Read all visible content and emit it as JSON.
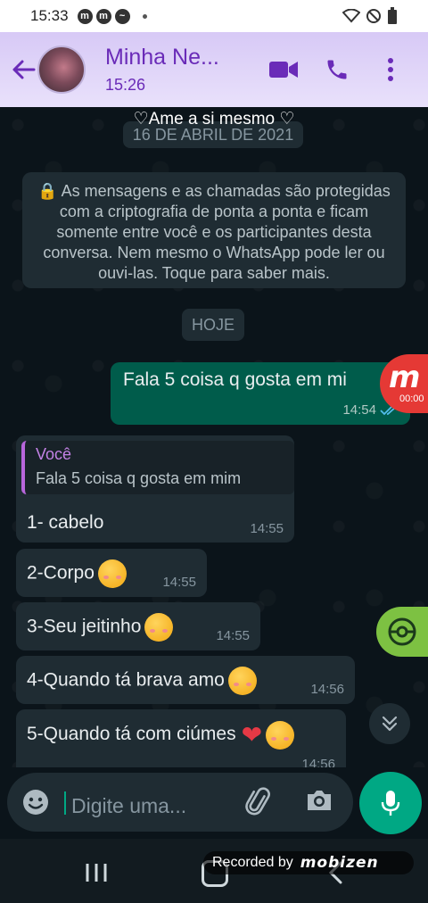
{
  "status_bar": {
    "time": "15:33",
    "badges": [
      "m",
      "m",
      "~"
    ]
  },
  "header": {
    "contact_name": "Minha Ne...",
    "subtitle": "15:26"
  },
  "overlay_text": "♡Ame a si mesmo ♡",
  "date_chip": "16 DE ABRIL DE 2021",
  "encryption_notice": "🔒 As mensagens e as chamadas são protegidas com a criptografia de ponta a ponta e ficam somente entre você e os participantes desta conversa. Nem mesmo o WhatsApp pode ler ou ouvi-las. Toque para saber mais.",
  "today_chip": "HOJE",
  "outgoing_message": {
    "text": "Fala 5 coisa q gosta em mi",
    "time": "14:54"
  },
  "quoted_reply": {
    "author": "Você",
    "text": "Fala 5 coisa q gosta em mim"
  },
  "incoming_messages": [
    {
      "text": "1- cabelo",
      "time": "14:55"
    },
    {
      "text": "2-Corpo",
      "time": "14:55"
    },
    {
      "text": "3-Seu jeitinho",
      "time": "14:55"
    },
    {
      "text": "4-Quando tá brava amo",
      "time": "14:56"
    },
    {
      "text": "5-Quando tá com ciúmes",
      "time": "14:56"
    }
  ],
  "recording_badge": {
    "timer": "00:00"
  },
  "input": {
    "placeholder": "Digite uma..."
  },
  "recorded_by": {
    "label": "Recorded by",
    "brand": "mobizen"
  },
  "colors": {
    "header_accent": "#6a2bb8",
    "outgoing_bubble": "#005c4b",
    "incoming_bubble": "#1f2c33",
    "whatsapp_green": "#00a884"
  }
}
